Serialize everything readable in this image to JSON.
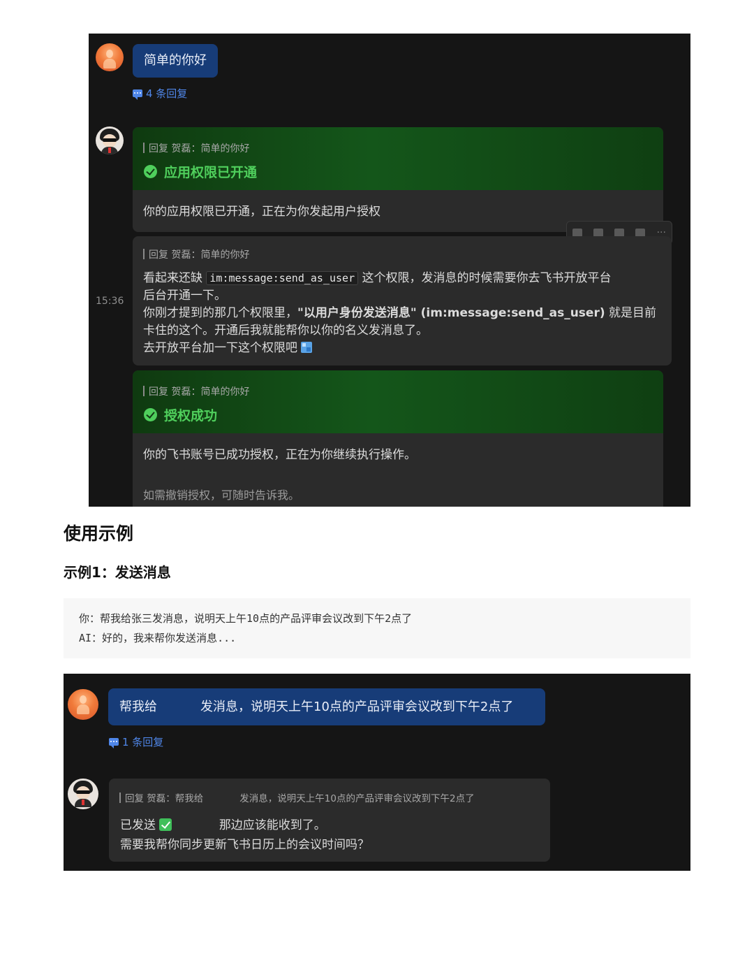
{
  "panel1": {
    "user_message": "简单的你好",
    "reply_count": "4 条回复",
    "timestamp": "15:36",
    "card1": {
      "quote": "回复 贺磊：简单的你好",
      "title": "应用权限已开通",
      "body": "你的应用权限已开通，正在为你发起用户授权"
    },
    "card2": {
      "quote": "回复 贺磊：简单的你好",
      "line1_pre": "看起来还缺",
      "line1_code": "im:message:send_as_user",
      "line1_post": "这个权限，发消息的时候需要你去飞书开放平台",
      "line2": "后台开通一下。",
      "line3_pre": "你刚才提到的那几个权限里，",
      "line3_bold": "\"以用户身份发送消息\" (im:message:send_as_user)",
      "line3_post": "就是目前",
      "line4": "卡住的这个。开通后我就能帮你以你的名义发消息了。",
      "line5": "去开放平台加一下这个权限吧"
    },
    "card3": {
      "quote": "回复 贺磊：简单的你好",
      "title": "授权成功",
      "body": "你的飞书账号已成功授权，正在为你继续执行操作。",
      "note": "如需撤销授权，可随时告诉我。"
    },
    "toolbar_more": "···"
  },
  "section": {
    "heading": "使用示例",
    "subheading": "示例1：发送消息"
  },
  "codeblock": {
    "line1": "你：帮我给张三发消息，说明天上午10点的产品评审会议改到下午2点了",
    "line2": "AI：好的，我来帮你发送消息..."
  },
  "panel2": {
    "user_message_pre": "帮我给",
    "user_message_post": "发消息，说明天上午10点的产品评审会议改到下午2点了",
    "reply_count": "1 条回复",
    "card": {
      "quote_pre": "回复 贺磊：帮我给",
      "quote_post": "发消息，说明天上午10点的产品评审会议改到下午2点了",
      "line1_pre": "已发送",
      "line1_post": "那边应该能收到了。",
      "line2": "需要我帮你同步更新飞书日历上的会议时间吗？"
    }
  },
  "colors": {
    "panel_bg": "#151515",
    "user_bubble": "#173c78",
    "reply_link": "#4f86e8",
    "success_green": "#4fcf5c",
    "card_bg": "#2b2b2b"
  },
  "icons": [
    "chat-bubble-icon",
    "check-circle-icon",
    "thumbs-up-icon",
    "comment-icon",
    "forward-icon",
    "pin-icon",
    "more-icon",
    "image-emoji-icon",
    "green-check-emoji-icon"
  ]
}
